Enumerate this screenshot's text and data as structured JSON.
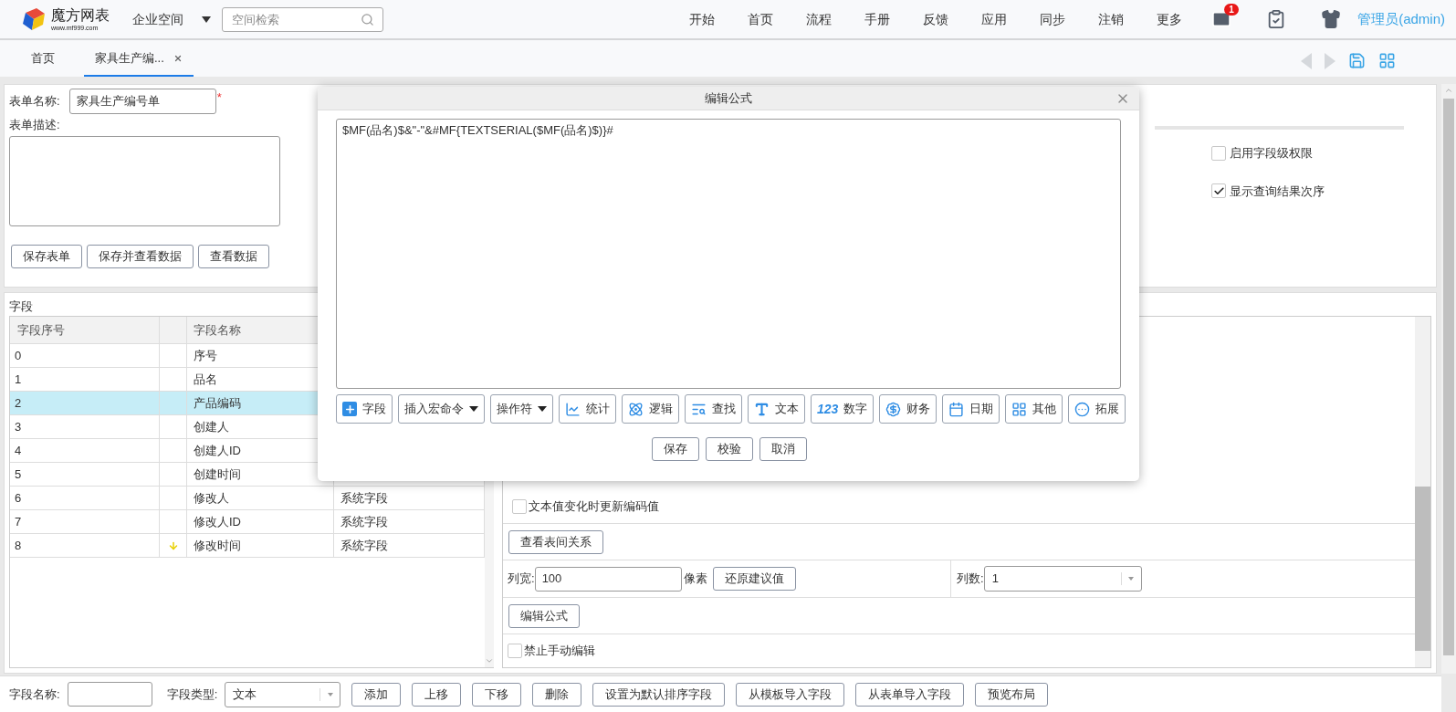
{
  "header": {
    "logo_name": "魔方网表",
    "logo_url": "www.mf999.com",
    "space_menu": "企业空间",
    "search": {
      "placeholder": "空间检索"
    },
    "nav": [
      "开始",
      "首页",
      "流程",
      "手册",
      "反馈",
      "应用",
      "同步",
      "注销",
      "更多"
    ],
    "mail_badge": "1",
    "user": "管理员(admin)"
  },
  "tabs": [
    {
      "label": "首页",
      "selected": false,
      "closable": false
    },
    {
      "label": "家具生产编...",
      "selected": true,
      "closable": true
    }
  ],
  "form": {
    "name_label": "表单名称:",
    "name_value": "家具生产编号单",
    "required_mark": "*",
    "desc_label": "表单描述:",
    "buttons": [
      "保存表单",
      "保存并查看数据",
      "查看数据"
    ]
  },
  "options": [
    {
      "label": "启用字段级权限",
      "checked": false
    },
    {
      "label": "显示查询结果次序",
      "checked": true
    }
  ],
  "fields": {
    "title": "字段",
    "columns": [
      "字段序号",
      "",
      "字段名称"
    ],
    "rows": [
      {
        "index": "0",
        "name": "序号",
        "selected": false,
        "moved": false
      },
      {
        "index": "1",
        "name": "品名",
        "selected": false,
        "moved": false
      },
      {
        "index": "2",
        "name": "产品编码",
        "selected": true,
        "moved": false
      },
      {
        "index": "3",
        "name": "创建人",
        "selected": false,
        "moved": false
      },
      {
        "index": "4",
        "name": "创建人ID",
        "selected": false,
        "moved": false
      },
      {
        "index": "5",
        "name": "创建时间",
        "selected": false,
        "moved": false
      },
      {
        "index": "6",
        "name": "修改人",
        "type": "系统字段",
        "selected": false,
        "moved": false
      },
      {
        "index": "7",
        "name": "修改人ID",
        "type": "系统字段",
        "selected": false,
        "moved": false
      },
      {
        "index": "8",
        "name": "修改时间",
        "type": "系统字段",
        "selected": false,
        "moved": true
      }
    ]
  },
  "properties": {
    "update_on_change": {
      "label": "文本值变化时更新编码值",
      "checked": false
    },
    "relations_button": "查看表间关系",
    "width_label": "列宽:",
    "width_value": "100",
    "width_unit": "像素",
    "restore_button": "还原建议值",
    "columns_label": "列数:",
    "columns_value": "1",
    "formula_button": "编辑公式",
    "no_manual_edit": {
      "label": "禁止手动编辑",
      "checked": false
    }
  },
  "bottom": {
    "name_label": "字段名称:",
    "type_label": "字段类型:",
    "type_value": "文本",
    "buttons": [
      "添加",
      "上移",
      "下移",
      "删除",
      "设置为默认排序字段",
      "从模板导入字段",
      "从表单导入字段",
      "预览布局"
    ]
  },
  "dialog": {
    "title": "编辑公式",
    "formula": "$MF(品名)$&\"-\"&#MF{TEXTSERIAL($MF(品名)$)}#",
    "tools": [
      {
        "label": "字段",
        "kind": "icon"
      },
      {
        "label": "插入宏命令",
        "kind": "menu"
      },
      {
        "label": "操作符",
        "kind": "menu"
      },
      {
        "label": "统计",
        "kind": "icon"
      },
      {
        "label": "逻辑",
        "kind": "icon"
      },
      {
        "label": "查找",
        "kind": "icon"
      },
      {
        "label": "文本",
        "kind": "icon"
      },
      {
        "label": "数字",
        "kind": "glyph",
        "glyph": "123"
      },
      {
        "label": "财务",
        "kind": "icon"
      },
      {
        "label": "日期",
        "kind": "icon"
      },
      {
        "label": "其他",
        "kind": "icon"
      },
      {
        "label": "拓展",
        "kind": "icon"
      }
    ],
    "actions": [
      "保存",
      "校验",
      "取消"
    ]
  }
}
